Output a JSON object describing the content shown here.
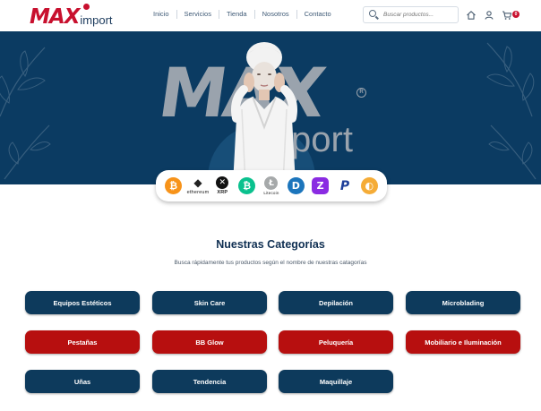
{
  "brand": {
    "logo_main": "MAX",
    "logo_sub": "import"
  },
  "nav": {
    "items": [
      "Inicio",
      "Servicios",
      "Tienda",
      "Nosotros",
      "Contacto"
    ]
  },
  "search": {
    "placeholder": "Buscar productos..."
  },
  "header_icons": {
    "home": "home-icon",
    "user": "user-icon",
    "cart": "cart-icon",
    "cart_count": "0"
  },
  "hero": {
    "big_text": "MAX",
    "small_text": "port",
    "reg_mark": "R"
  },
  "payments": [
    {
      "name": "bitcoin",
      "symbol": "₿",
      "color": "#f7931a",
      "label": ""
    },
    {
      "name": "ethereum",
      "symbol": "◆",
      "color": "#222222",
      "label": "ethereum"
    },
    {
      "name": "xrp",
      "symbol": "✕",
      "color": "#111111",
      "label": "XRP"
    },
    {
      "name": "bitcoin-cash",
      "symbol": "₿",
      "color": "#0ac18e",
      "label": ""
    },
    {
      "name": "litecoin",
      "symbol": "Ł",
      "color": "#a6a9aa",
      "label": "Litecoin"
    },
    {
      "name": "dash",
      "symbol": "D",
      "color": "#1c75bc",
      "label": ""
    },
    {
      "name": "zcash",
      "symbol": "Z",
      "color": "#8a2be2",
      "label": ""
    },
    {
      "name": "paypal",
      "symbol": "P",
      "color": "#ffffff",
      "label": ""
    },
    {
      "name": "dai",
      "symbol": "◐",
      "color": "#f5ac37",
      "label": ""
    }
  ],
  "categories_section": {
    "title": "Nuestras Categorías",
    "subtitle": "Busca rápidamente tus productos según el nombre de nuestras catagorías"
  },
  "categories": [
    {
      "label": "Equipos Estéticos",
      "color": "navy"
    },
    {
      "label": "Skin Care",
      "color": "navy"
    },
    {
      "label": "Depilación",
      "color": "navy"
    },
    {
      "label": "Microblading",
      "color": "navy"
    },
    {
      "label": "Pestañas",
      "color": "red"
    },
    {
      "label": "BB Glow",
      "color": "red"
    },
    {
      "label": "Peluquería",
      "color": "red"
    },
    {
      "label": "Mobiliario e Iluminación",
      "color": "red"
    },
    {
      "label": "Uñas",
      "color": "navy"
    },
    {
      "label": "Tendencia",
      "color": "navy"
    },
    {
      "label": "Maquillaje",
      "color": "navy"
    }
  ],
  "colors": {
    "navy": "#0d3a5c",
    "red": "#b70f0f",
    "hero_bg": "#0b3b62"
  }
}
